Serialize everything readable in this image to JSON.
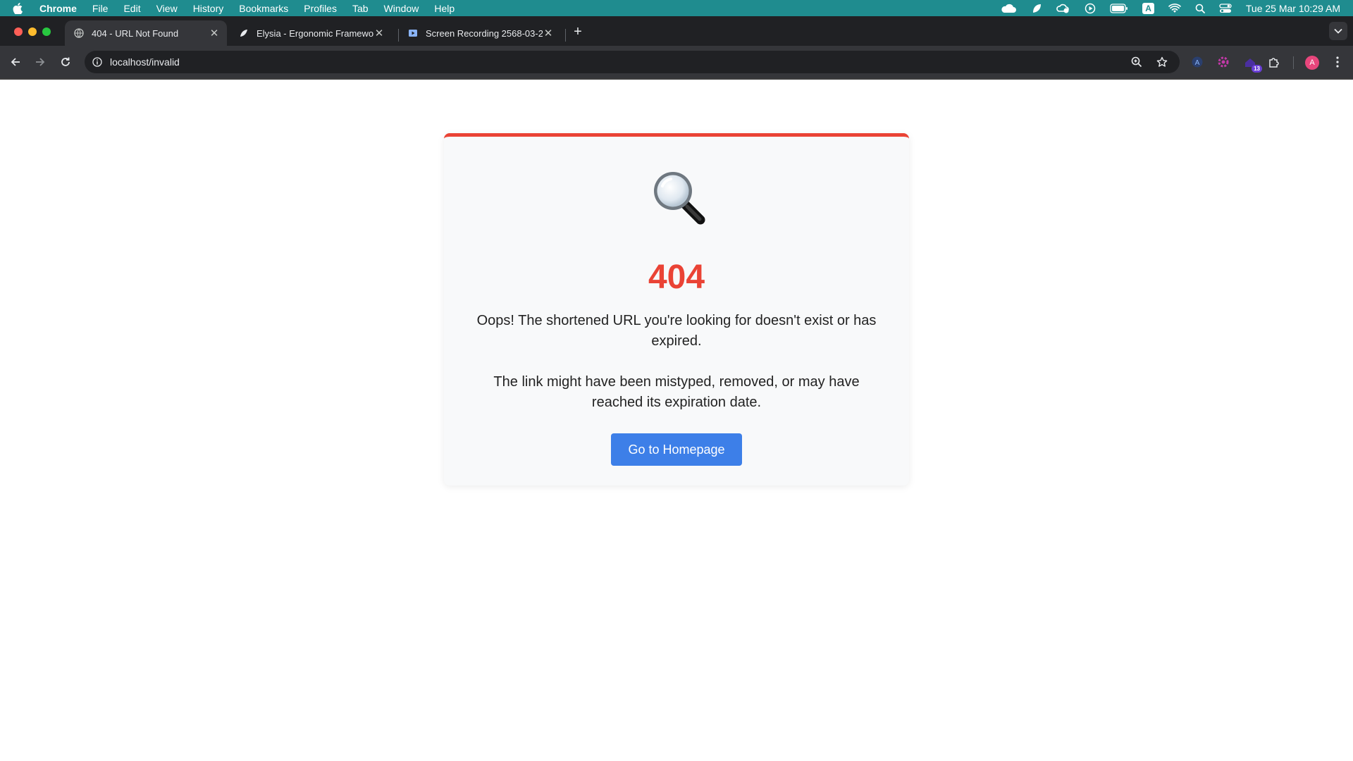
{
  "menubar": {
    "app_name": "Chrome",
    "items": [
      "File",
      "Edit",
      "View",
      "History",
      "Bookmarks",
      "Profiles",
      "Tab",
      "Window",
      "Help"
    ],
    "clock": "Tue 25 Mar  10:29 AM",
    "input_indicator": "A"
  },
  "tabs": [
    {
      "title": "404 - URL Not Found",
      "active": true
    },
    {
      "title": "Elysia - Ergonomic Framewor",
      "active": false
    },
    {
      "title": "Screen Recording 2568-03-2",
      "active": false
    }
  ],
  "toolbar": {
    "url": "localhost/invalid",
    "extension_badge": "13",
    "profile_initial": "A"
  },
  "page": {
    "emoji": "search-magnifier-icon",
    "error_code": "404",
    "message_1": "Oops! The shortened URL you're looking for doesn't exist or has expired.",
    "message_2": "The link might have been mistyped, removed, or may have reached its expiration date.",
    "button_label": "Go to Homepage"
  },
  "colors": {
    "accent_red": "#ea4335",
    "button_blue": "#3d7fe8",
    "menubar": "#1f8c8f"
  }
}
